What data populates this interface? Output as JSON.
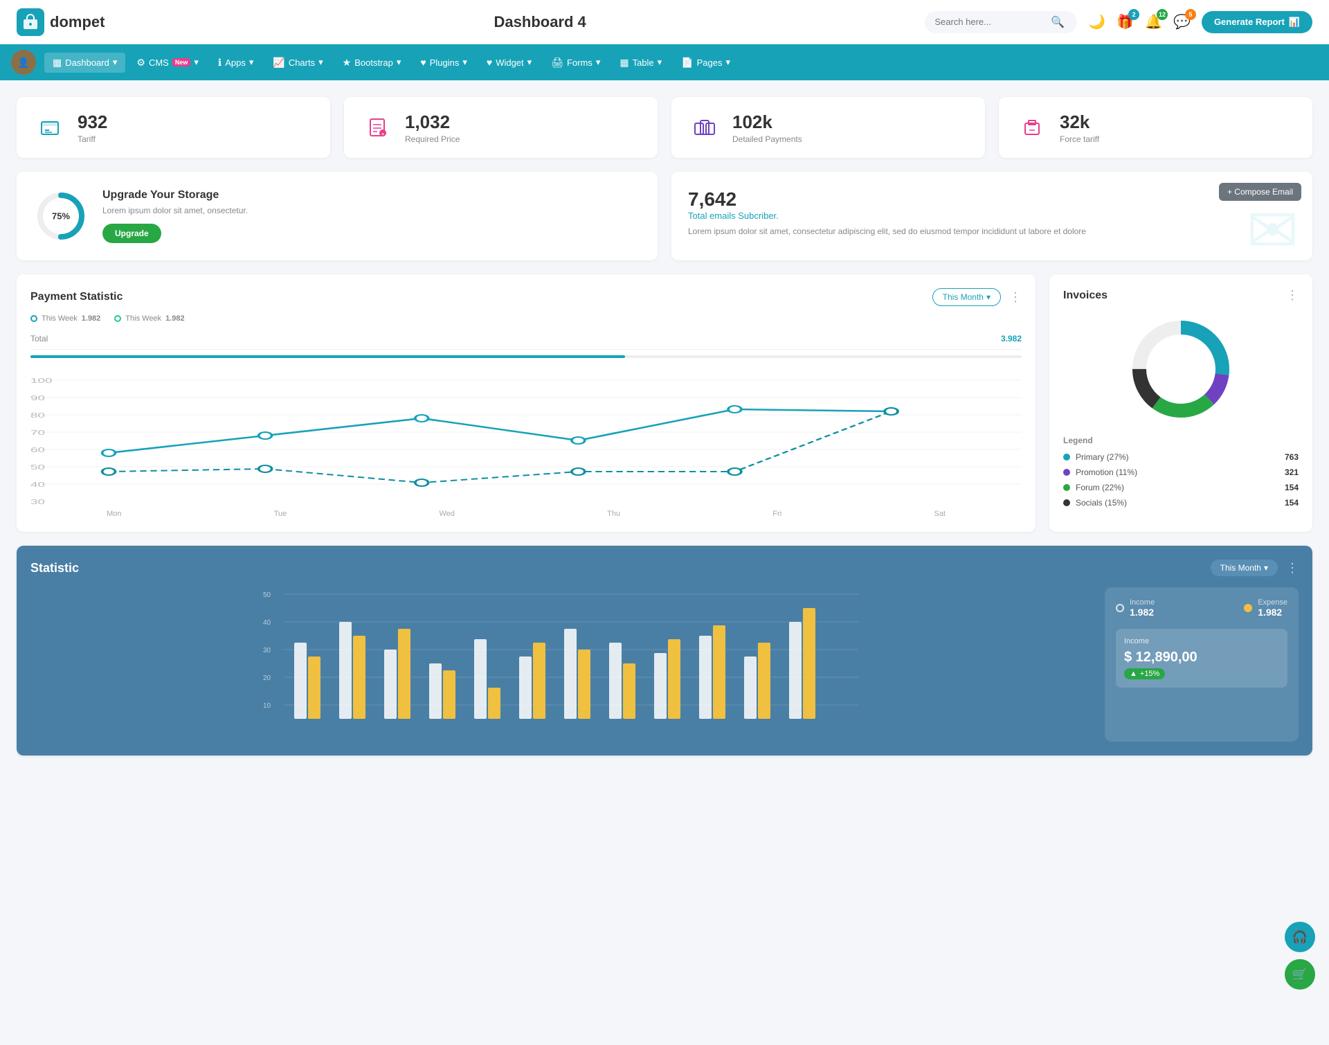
{
  "header": {
    "logo_text": "dompet",
    "page_title": "Dashboard 4",
    "search_placeholder": "Search here...",
    "generate_report_label": "Generate Report",
    "badge_gift": "2",
    "badge_bell": "12",
    "badge_chat": "5"
  },
  "nav": {
    "items": [
      {
        "id": "dashboard",
        "label": "Dashboard",
        "icon": "▦",
        "active": true
      },
      {
        "id": "cms",
        "label": "CMS",
        "icon": "⚙",
        "badge_new": true
      },
      {
        "id": "apps",
        "label": "Apps",
        "icon": "ℹ"
      },
      {
        "id": "charts",
        "label": "Charts",
        "icon": "📈"
      },
      {
        "id": "bootstrap",
        "label": "Bootstrap",
        "icon": "★"
      },
      {
        "id": "plugins",
        "label": "Plugins",
        "icon": "♥"
      },
      {
        "id": "widget",
        "label": "Widget",
        "icon": "♥"
      },
      {
        "id": "forms",
        "label": "Forms",
        "icon": "🖨"
      },
      {
        "id": "table",
        "label": "Table",
        "icon": "▦"
      },
      {
        "id": "pages",
        "label": "Pages",
        "icon": "📄"
      }
    ]
  },
  "stats": [
    {
      "value": "932",
      "label": "Tariff",
      "icon": "🏢",
      "color": "teal"
    },
    {
      "value": "1,032",
      "label": "Required Price",
      "icon": "📄",
      "color": "red"
    },
    {
      "value": "102k",
      "label": "Detailed Payments",
      "icon": "▦",
      "color": "purple"
    },
    {
      "value": "32k",
      "label": "Force tariff",
      "icon": "🏢",
      "color": "pink"
    }
  ],
  "storage": {
    "percent": 75,
    "percent_label": "75%",
    "title": "Upgrade Your Storage",
    "description": "Lorem ipsum dolor sit amet, onsectetur.",
    "upgrade_label": "Upgrade"
  },
  "email": {
    "count": "7,642",
    "label": "Total emails Subcriber.",
    "description": "Lorem ipsum dolor sit amet, consectetur adipiscing elit, sed do eiusmod tempor incididunt ut labore et dolore",
    "compose_label": "+ Compose Email"
  },
  "payment_statistic": {
    "title": "Payment Statistic",
    "this_month_label": "This Month",
    "legend_1_label": "This Week",
    "legend_1_value": "1.982",
    "legend_2_label": "This Week",
    "legend_2_value": "1.982",
    "total_label": "Total",
    "total_value": "3.982",
    "x_labels": [
      "Mon",
      "Tue",
      "Wed",
      "Thu",
      "Fri",
      "Sat"
    ],
    "y_labels": [
      "100",
      "90",
      "80",
      "70",
      "60",
      "50",
      "40",
      "30"
    ]
  },
  "invoices": {
    "title": "Invoices",
    "legend": [
      {
        "label": "Primary (27%)",
        "color": "#17a2b8",
        "value": "763"
      },
      {
        "label": "Promotion (11%)",
        "color": "#6f42c1",
        "value": "321"
      },
      {
        "label": "Forum (22%)",
        "color": "#28a745",
        "value": "154"
      },
      {
        "label": "Socials (15%)",
        "color": "#333",
        "value": "154"
      }
    ],
    "legend_title": "Legend"
  },
  "statistic": {
    "title": "Statistic",
    "this_month_label": "This Month",
    "y_labels": [
      "50",
      "40",
      "30",
      "20",
      "10"
    ],
    "income_label": "Income",
    "income_value": "1.982",
    "expense_label": "Expense",
    "expense_value": "1.982",
    "income_detail_label": "Income",
    "income_detail_value": "$ 12,890,00",
    "income_badge": "+15%"
  }
}
